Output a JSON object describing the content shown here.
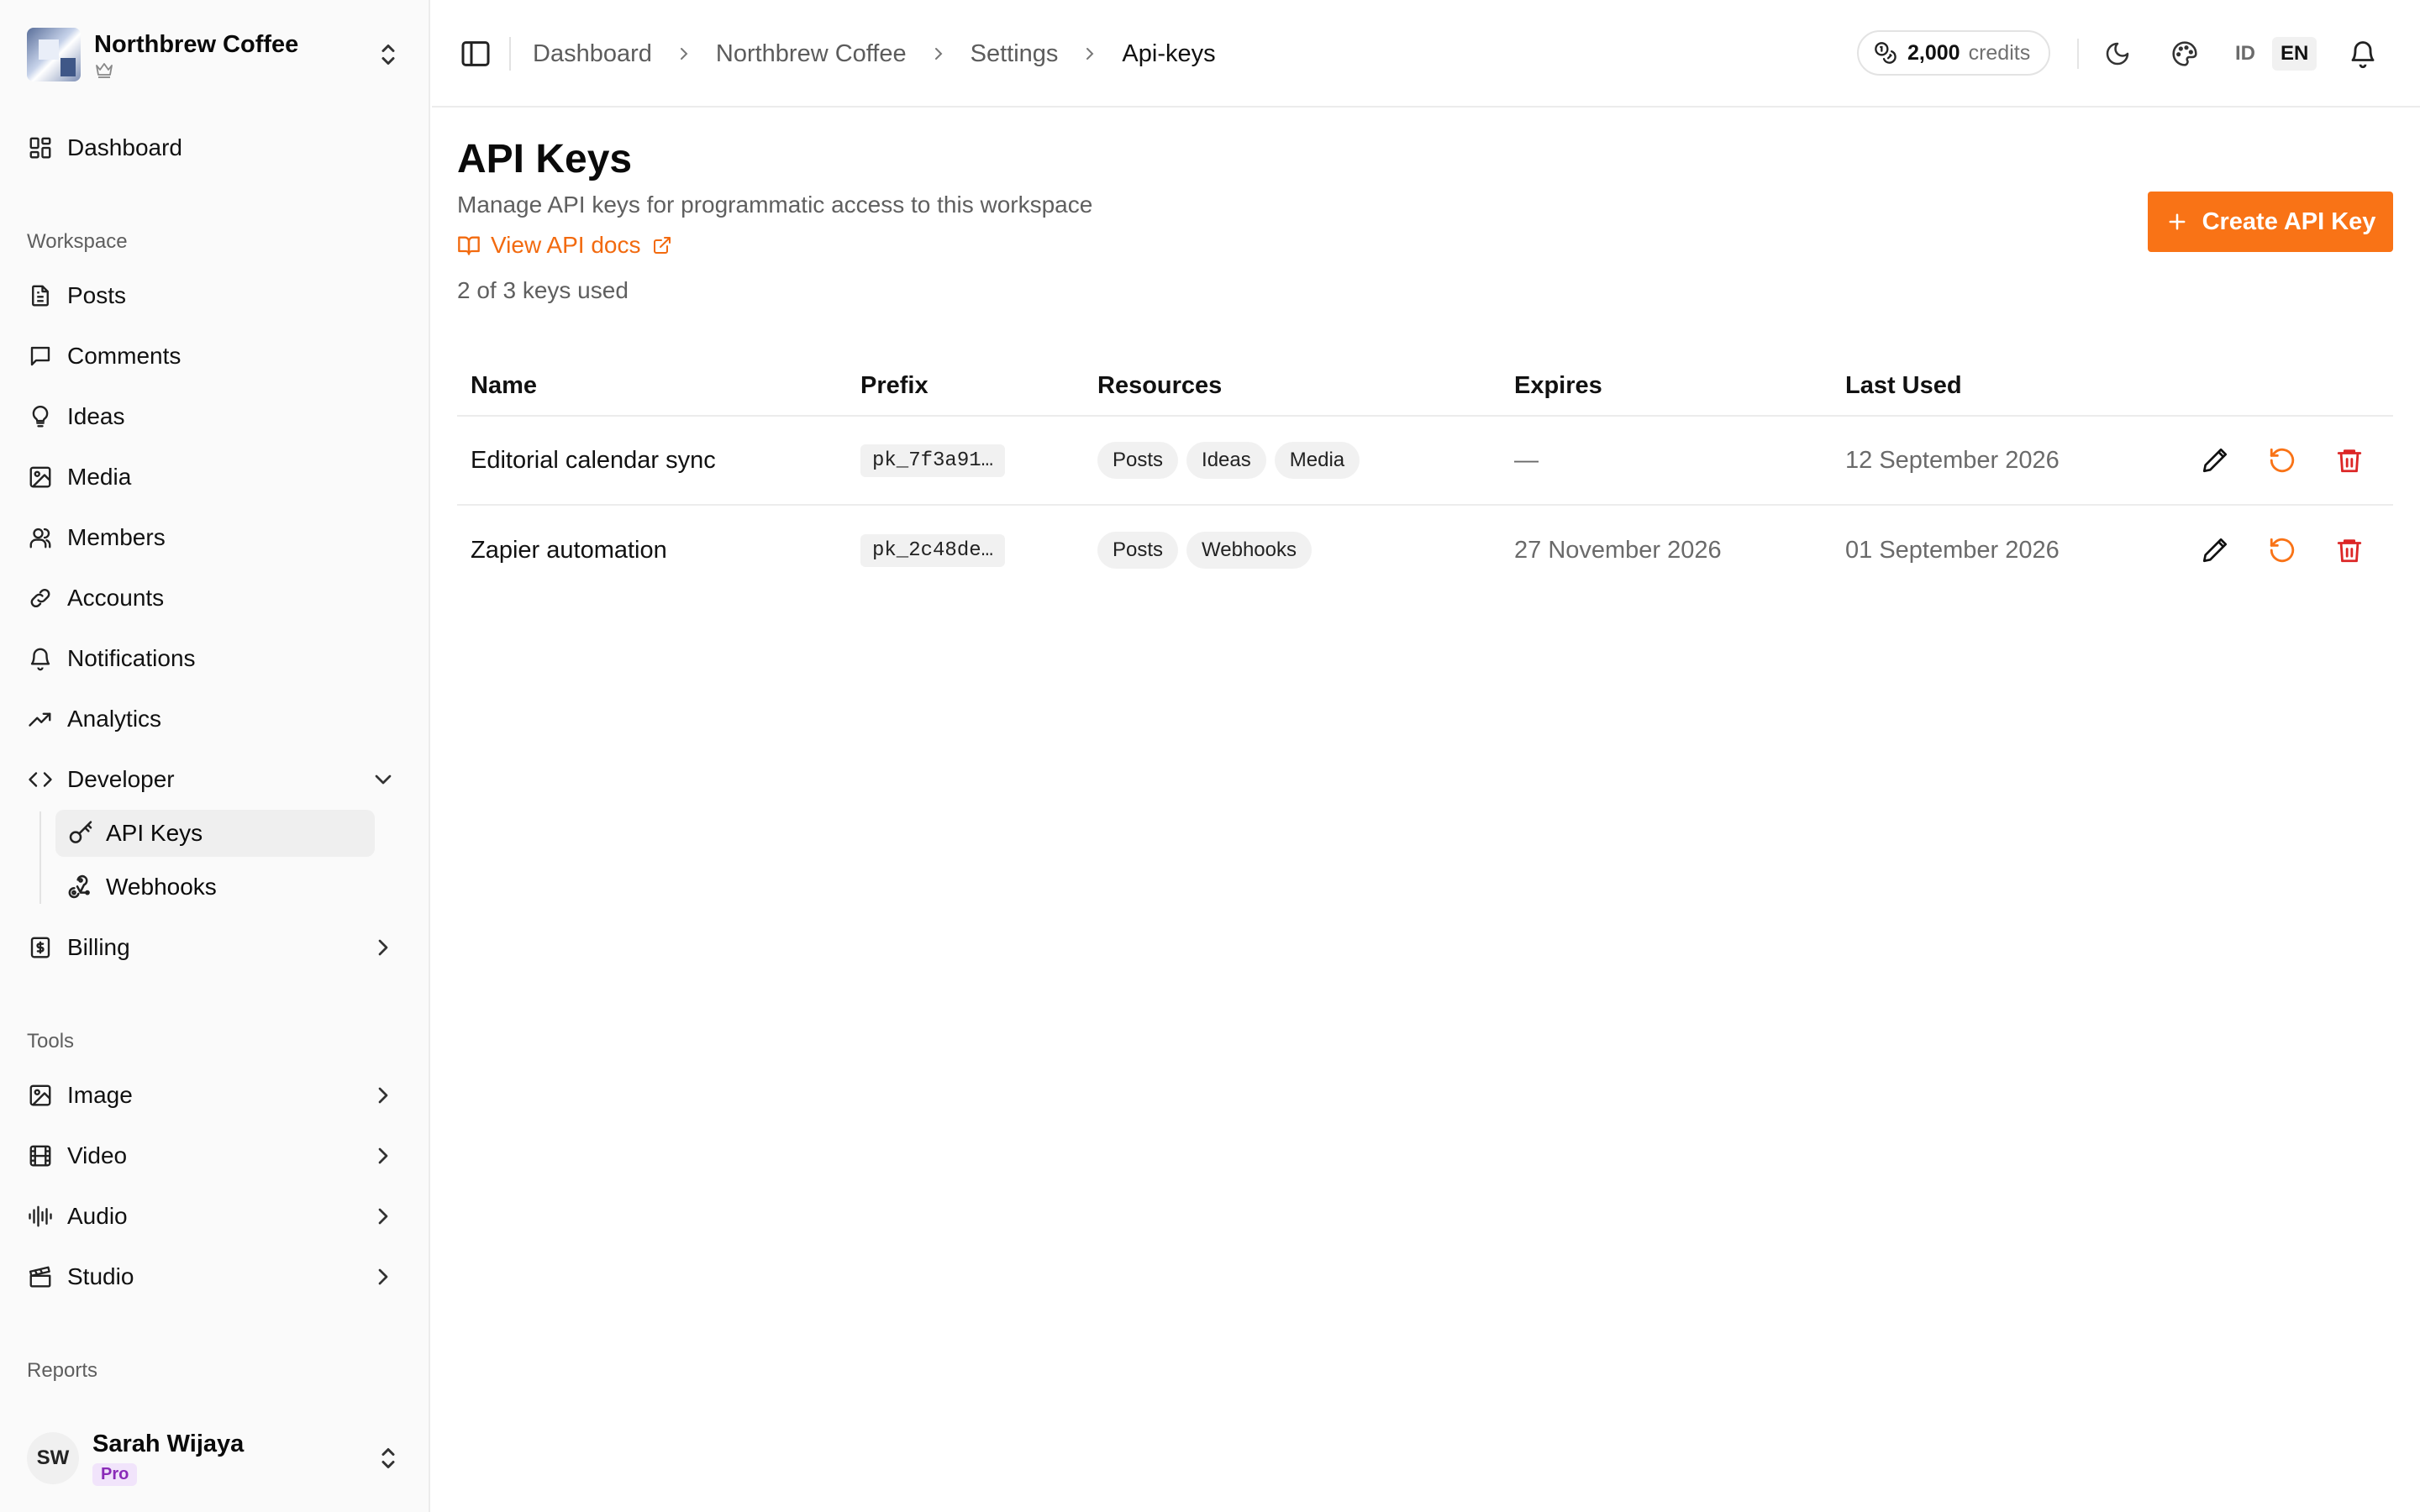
{
  "workspace": {
    "name": "Northbrew Coffee"
  },
  "sidebar": {
    "dashboard": "Dashboard",
    "workspace_label": "Workspace",
    "workspace_items": [
      "Posts",
      "Comments",
      "Ideas",
      "Media",
      "Members",
      "Accounts",
      "Notifications",
      "Analytics"
    ],
    "developer": "Developer",
    "developer_sub": [
      "API Keys",
      "Webhooks"
    ],
    "billing": "Billing",
    "tools_label": "Tools",
    "tools_items": [
      "Image",
      "Video",
      "Audio",
      "Studio"
    ],
    "reports_label": "Reports"
  },
  "user": {
    "initials": "SW",
    "name": "Sarah Wijaya",
    "plan": "Pro"
  },
  "header": {
    "breadcrumb": [
      "Dashboard",
      "Northbrew Coffee",
      "Settings",
      "Api-keys"
    ],
    "credits_value": "2,000",
    "credits_unit": "credits",
    "lang_id": "ID",
    "lang_en": "EN"
  },
  "page": {
    "title": "API Keys",
    "description": "Manage API keys for programmatic access to this workspace",
    "docs_link": "View API docs",
    "usage": "2 of 3 keys used",
    "create_button": "Create API Key"
  },
  "table": {
    "columns": [
      "Name",
      "Prefix",
      "Resources",
      "Expires",
      "Last Used"
    ],
    "rows": [
      {
        "name": "Editorial calendar sync",
        "prefix": "pk_7f3a91…",
        "resources": [
          "Posts",
          "Ideas",
          "Media"
        ],
        "expires": "—",
        "last_used": "12 September 2026"
      },
      {
        "name": "Zapier automation",
        "prefix": "pk_2c48de…",
        "resources": [
          "Posts",
          "Webhooks"
        ],
        "expires": "27 November 2026",
        "last_used": "01 September 2026"
      }
    ]
  },
  "colors": {
    "accent": "#f97316",
    "danger": "#dc2626",
    "plan_badge": "#8a2bb8"
  }
}
